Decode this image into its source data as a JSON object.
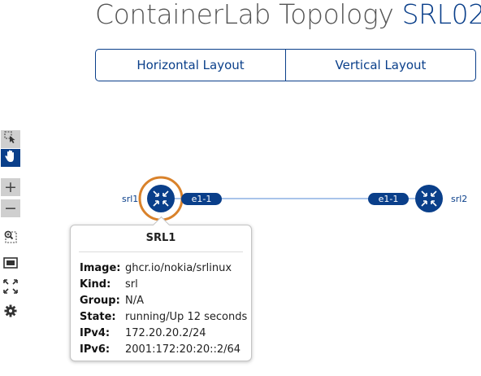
{
  "header": {
    "title_main": "ContainerLab Topology",
    "title_accent": "SRL02"
  },
  "layout_buttons": {
    "horizontal": "Horizontal Layout",
    "vertical": "Vertical Layout"
  },
  "toolbar": {
    "tools": [
      "select-tool-icon",
      "pan-hand-icon",
      "zoom-in",
      "zoom-out",
      "zoom-area-icon",
      "fit-icon",
      "fullscreen-icon",
      "gear-icon"
    ],
    "zoom_in": "+",
    "zoom_out": "−"
  },
  "topology": {
    "nodes": [
      {
        "name": "srl1"
      },
      {
        "name": "srl2"
      }
    ],
    "link": {
      "a_iface": "e1-1",
      "b_iface": "e1-1"
    }
  },
  "popup": {
    "title": "SRL1",
    "rows": [
      {
        "key": "Image:",
        "value": "ghcr.io/nokia/srlinux"
      },
      {
        "key": "Kind:",
        "value": "srl"
      },
      {
        "key": "Group:",
        "value": "N/A"
      },
      {
        "key": "State:",
        "value": "running/Up 12 seconds"
      },
      {
        "key": "IPv4:",
        "value": "172.20.20.2/24"
      },
      {
        "key": "IPv6:",
        "value": "2001:172:20:20::2/64"
      }
    ]
  },
  "colors": {
    "accent": "#0a3f8a",
    "highlight": "#d9822b",
    "link": "#a9c4ea"
  }
}
